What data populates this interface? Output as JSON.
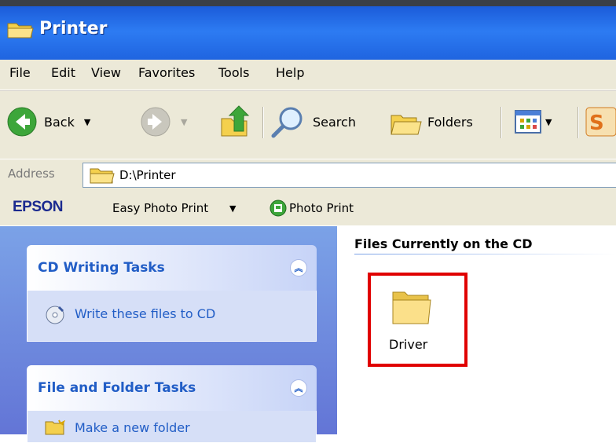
{
  "window": {
    "title": "Printer"
  },
  "menu": [
    "File",
    "Edit",
    "View",
    "Favorites",
    "Tools",
    "Help"
  ],
  "toolbar": {
    "back_label": "Back",
    "search_label": "Search",
    "folders_label": "Folders"
  },
  "address": {
    "label": "Address",
    "value": "D:\\Printer"
  },
  "epson": {
    "brand": "EPSON",
    "easy_photo_print": "Easy Photo Print",
    "photo_print": "Photo Print"
  },
  "left_panel": {
    "cd_tasks": {
      "title": "CD Writing Tasks",
      "items": [
        "Write these files to CD"
      ]
    },
    "file_tasks": {
      "title": "File and Folder Tasks",
      "items": [
        "Make a new folder"
      ]
    }
  },
  "content": {
    "section_title": "Files Currently on the CD",
    "items": [
      {
        "name": "Driver",
        "type": "folder"
      }
    ]
  },
  "colors": {
    "title_blue": "#2d7bf2",
    "task_link": "#215dc6",
    "highlight": "#e00000",
    "panel_blue": "#7ba2e7"
  }
}
